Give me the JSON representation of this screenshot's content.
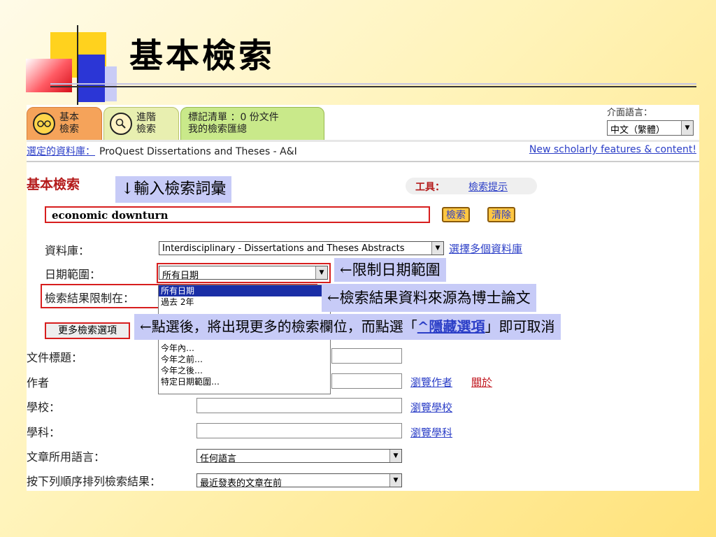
{
  "slide_title": "基本檢索",
  "tabs": [
    {
      "line1": "基本",
      "line2": "檢索"
    },
    {
      "line1": "進階",
      "line2": "檢索"
    },
    {
      "line1": "標記清單 ：0 份文件",
      "line2": "我的檢索匯總"
    }
  ],
  "interface_language": {
    "label": "介面語言：",
    "value": "中文（繁體）"
  },
  "database_line": {
    "label": "選定的資料庫：",
    "value": "ProQuest Dissertations and Theses - A&I",
    "new_features_link": "New scholarly features & content!"
  },
  "section_title": "基本檢索",
  "tools": {
    "label": "工具：",
    "link": "檢索提示"
  },
  "search": {
    "value": "economic downturn",
    "search_button": "檢索",
    "clear_button": "清除"
  },
  "form": {
    "database_label": "資料庫：",
    "database_value": "Interdisciplinary - Dissertations and Theses Abstracts",
    "select_multiple_link": "選擇多個資料庫",
    "date_label": "日期範圍：",
    "date_value": "所有日期",
    "limit_label": "檢索結果限制在：",
    "date_options": [
      "所有日期",
      "過去 2年",
      "今年內…",
      "今年之前…",
      "今年之後…",
      "特定日期範圍…"
    ],
    "more_options_button": "更多檢索選項",
    "doc_title_label": "文件標題：",
    "author_label": "作者",
    "browse_author_link": "瀏覽作者",
    "about_link": "關於",
    "school_label": "學校：",
    "browse_school_link": "瀏覽學校",
    "subject_label": "學科：",
    "browse_subject_link": "瀏覽學科",
    "language_label": "文章所用語言：",
    "language_value": "任何語言",
    "sort_label": "按下列順序排列檢索結果：",
    "sort_value": "最近發表的文章在前"
  },
  "annotations": {
    "enter_terms": "↓輸入檢索詞彙",
    "limit_date": "←限制日期範圍",
    "source_dissertations": "←檢索結果資料來源為博士論文",
    "more_fields_prefix": "←點選後，將出現更多的檢索欄位，而點選「",
    "more_fields_link": "^隱藏選項",
    "more_fields_suffix": "」即可取消"
  },
  "colors": {
    "accent_red": "#d71e1e",
    "link_blue": "#2b3ec7",
    "annotation_bg": "#c7cbf7",
    "tab_orange": "#f5a35a",
    "tab_green": "#c9e98a"
  }
}
